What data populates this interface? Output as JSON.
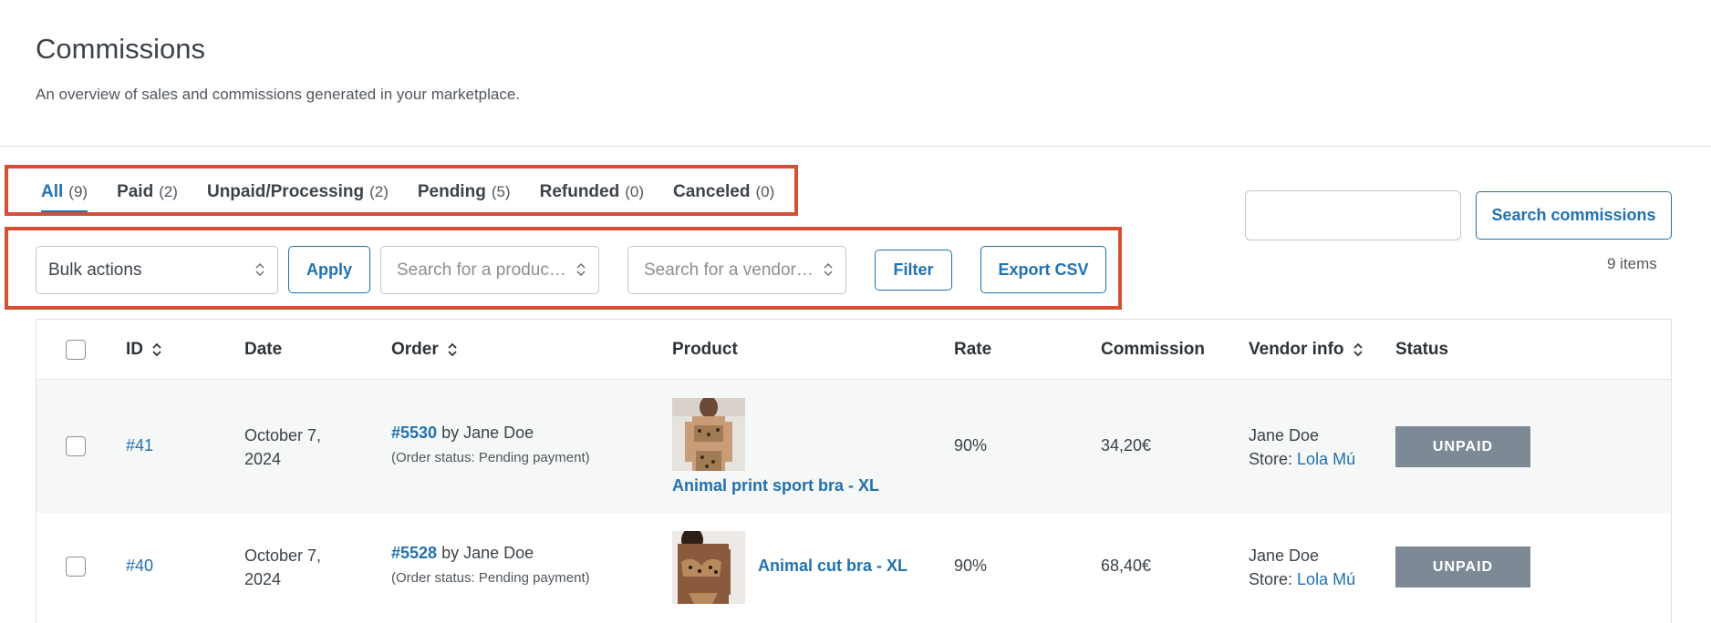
{
  "page": {
    "title": "Commissions",
    "description": "An overview of sales and commissions generated in your marketplace."
  },
  "tabs": [
    {
      "label": "All",
      "count": "(9)"
    },
    {
      "label": "Paid",
      "count": "(2)"
    },
    {
      "label": "Unpaid/Processing",
      "count": "(2)"
    },
    {
      "label": "Pending",
      "count": "(5)"
    },
    {
      "label": "Refunded",
      "count": "(0)"
    },
    {
      "label": "Canceled",
      "count": "(0)"
    }
  ],
  "search": {
    "placeholder": "",
    "button_label": "Search commissions"
  },
  "items_count": "9 items",
  "toolbar": {
    "bulk_actions": "Bulk actions",
    "apply_label": "Apply",
    "product_search_placeholder": "Search for a produc…",
    "vendor_search_placeholder": "Search for a vendor…",
    "filter_label": "Filter",
    "export_label": "Export CSV"
  },
  "table": {
    "headers": {
      "id": "ID",
      "date": "Date",
      "order": "Order",
      "product": "Product",
      "rate": "Rate",
      "commission": "Commission",
      "vendor_info": "Vendor info",
      "status": "Status"
    },
    "rows": [
      {
        "id": "#41",
        "date_line1": "October 7,",
        "date_line2": "2024",
        "order_number": "#5530",
        "order_by": "by Jane Doe",
        "order_status": "(Order status: Pending payment)",
        "product": "Animal print sport bra - XL",
        "rate": "90%",
        "commission": "34,20€",
        "vendor_name": "Jane Doe",
        "store_label": "Store:",
        "store_name": "Lola Mú",
        "status": "UNPAID"
      },
      {
        "id": "#40",
        "date_line1": "October 7,",
        "date_line2": "2024",
        "order_number": "#5528",
        "order_by": "by Jane Doe",
        "order_status": "(Order status: Pending payment)",
        "product": "Animal cut bra - XL",
        "rate": "90%",
        "commission": "68,40€",
        "vendor_name": "Jane Doe",
        "store_label": "Store:",
        "store_name": "Lola Mú",
        "status": "UNPAID"
      }
    ]
  },
  "colors": {
    "accent": "#2271b1",
    "highlight": "#d54f35",
    "status_unpaid": "#7d8a96"
  }
}
